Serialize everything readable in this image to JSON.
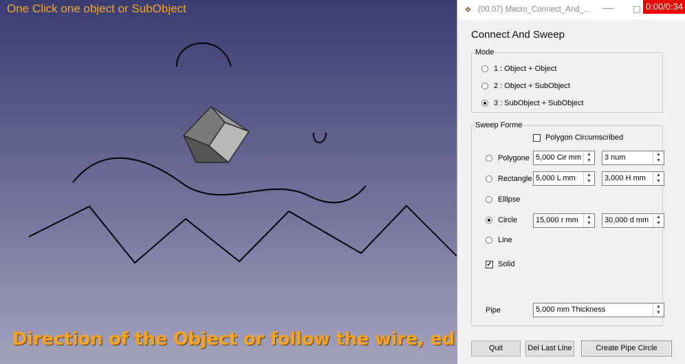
{
  "viewport": {
    "top_hint": "One Click one object or SubObject",
    "caption": "Direction of the Object or follow the wire, edge"
  },
  "window": {
    "title": "(00.07) Macro_Connect_And_...",
    "timer": "0:00/0:34"
  },
  "dialog": {
    "heading": "Connect And Sweep",
    "mode": {
      "legend": "Mode",
      "options": [
        {
          "label": "1 : Object + Object",
          "selected": false
        },
        {
          "label": "2 : Object + SubObject",
          "selected": false
        },
        {
          "label": "3 : SubObject + SubObject",
          "selected": true
        }
      ]
    },
    "sweep": {
      "legend": "Sweep Forme",
      "polygon_circumscribed": {
        "label": "Polygon Circumscribed",
        "checked": false
      },
      "polygone": {
        "label": "Polygone",
        "value1": "5,000 Cir mm",
        "value2": "3 num"
      },
      "rectangle": {
        "label": "Rectangle",
        "value1": "5,000 L mm",
        "value2": "3,000 H mm"
      },
      "ellipse": {
        "label": "Ellipse"
      },
      "circle": {
        "label": "Circle",
        "value1": "15,000 r mm",
        "value2": "30,000 d mm",
        "selected": true
      },
      "line": {
        "label": "Line"
      },
      "solid": {
        "label": "Solid",
        "checked": true
      },
      "pipe": {
        "label": "Pipe",
        "value": "5,000 mm Thickness"
      }
    },
    "buttons": {
      "quit": "Quit",
      "del_last_line": "Del Last Line",
      "create": "Create Pipe Circle"
    }
  },
  "colors": {
    "caption": "#f7a21b",
    "timer_bg": "#ee0000"
  }
}
